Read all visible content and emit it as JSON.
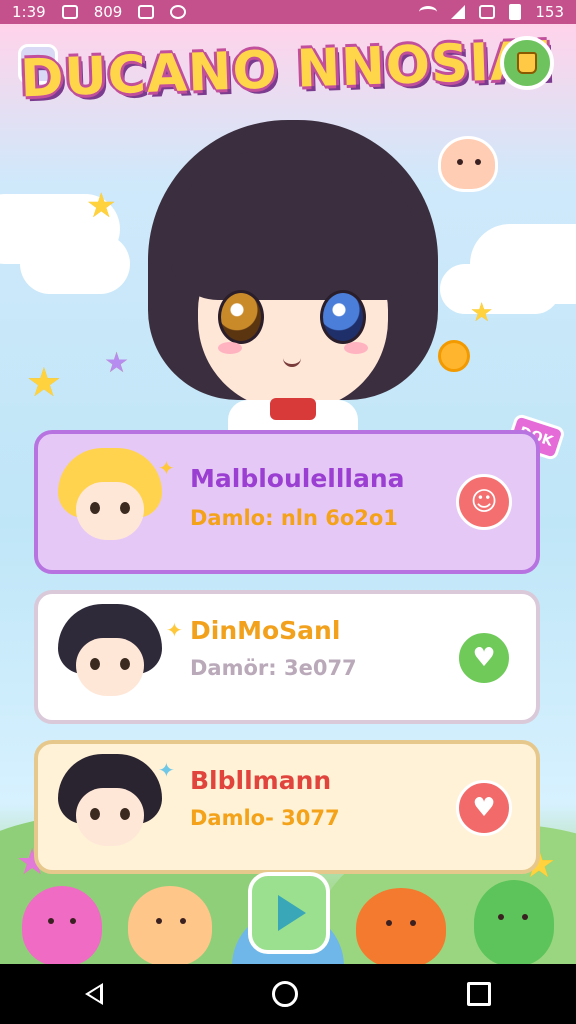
{
  "status_bar": {
    "time": "1:39",
    "left_text": "809",
    "right_text": "153"
  },
  "header": {
    "title": "DUCANO NNOSIA!",
    "back_icon": "back-arrow-icon",
    "shop_icon": "cup-icon"
  },
  "side_tag": {
    "label": "DOK"
  },
  "cards": [
    {
      "name": "Malbloulelllana",
      "score": "Damlo: nln 6o2o1",
      "action_icon": "smiley-face-icon",
      "name_color": "#9a3fd1",
      "bg": "#e6c8f7",
      "border": "#b774e0",
      "action_color": "#f46f6f"
    },
    {
      "name": "DinMoSanl",
      "score": "Damör: 3e077",
      "action_icon": "heart-icon",
      "name_color": "#f2a11c",
      "bg": "#ffffff",
      "border": "#d9c9d9",
      "action_color": "#6fca5a"
    },
    {
      "name": "Blbllmann",
      "score": "Damlo- 3077",
      "action_icon": "heart-icon",
      "name_color": "#e0443d",
      "bg": "#fff2d6",
      "border": "#e7c88c",
      "action_color": "#f26a6a"
    }
  ],
  "bottom": {
    "play_icon": "play-icon"
  },
  "nav": {
    "back_icon": "nav-back-icon",
    "home_icon": "nav-home-icon",
    "recent_icon": "nav-recent-icon"
  }
}
